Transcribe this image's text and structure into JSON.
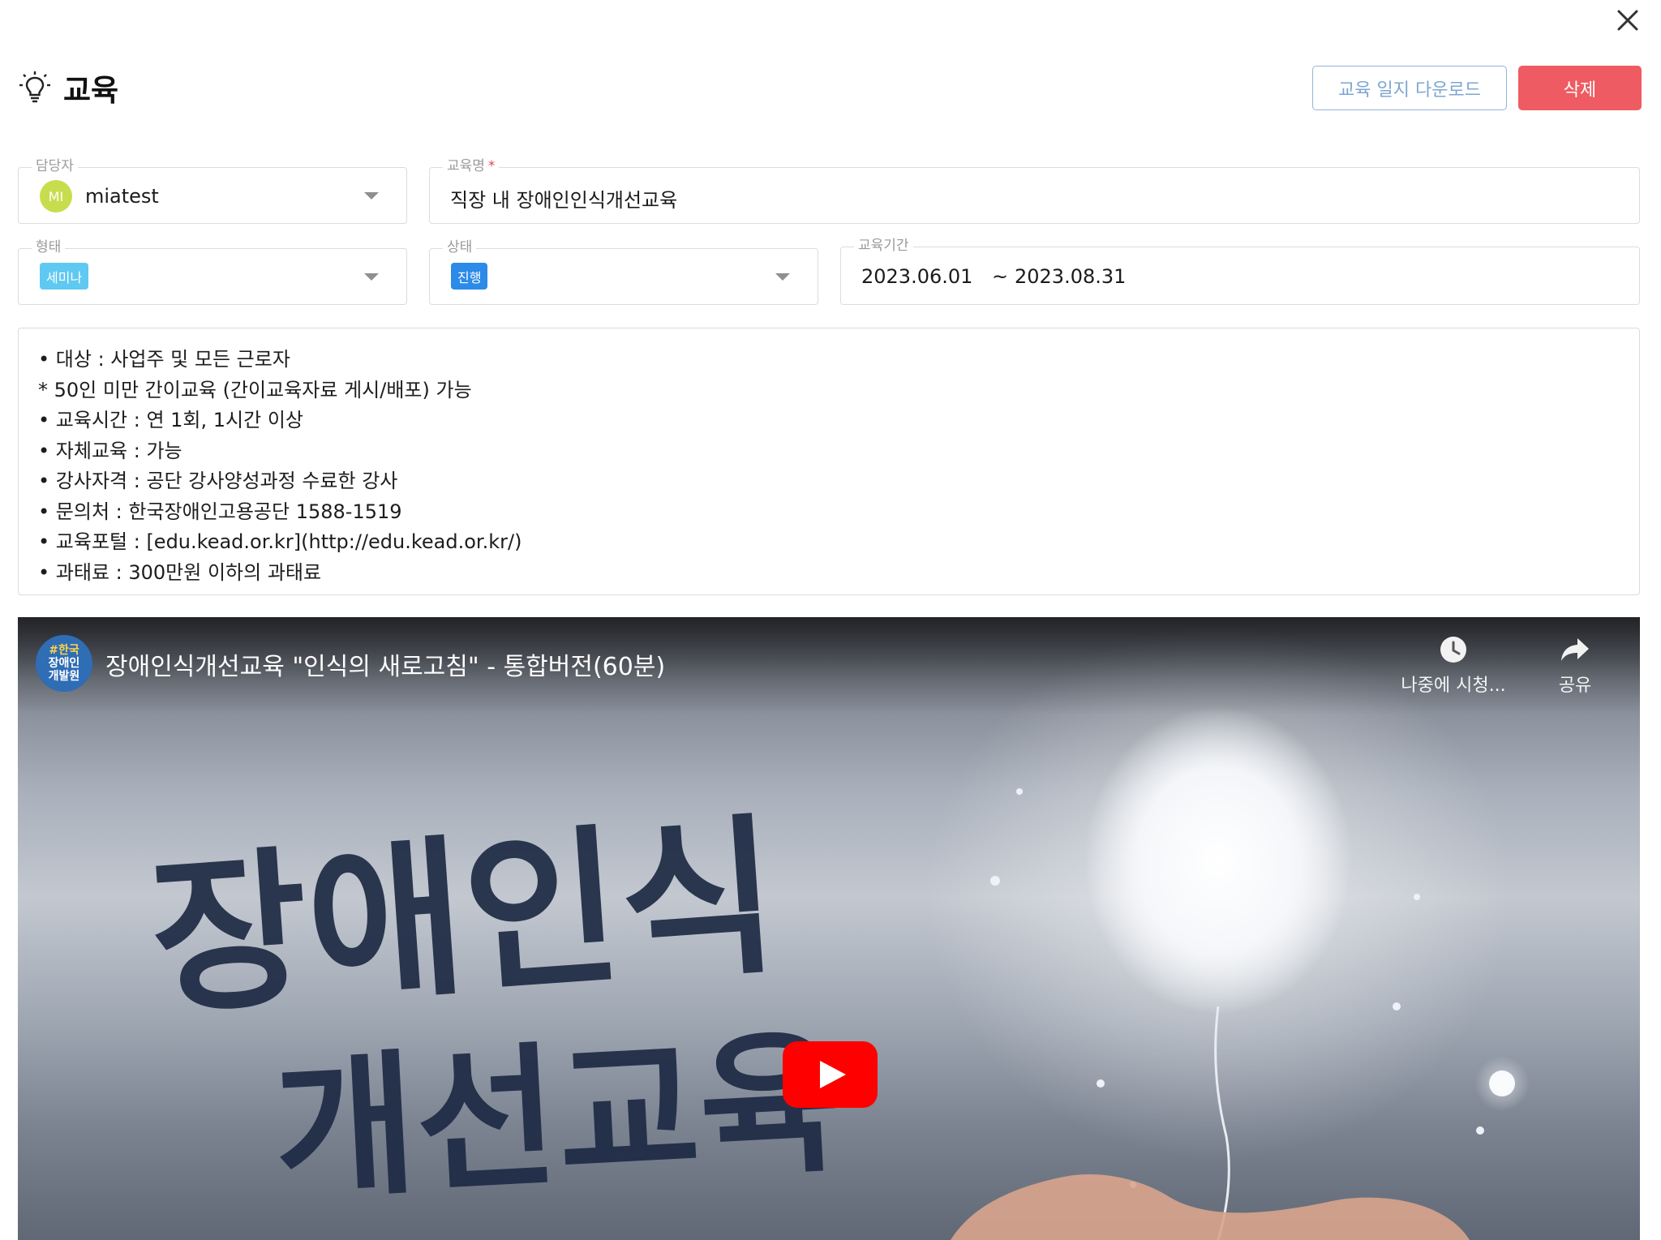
{
  "header": {
    "title": "교육",
    "icon": "lightbulb-icon"
  },
  "actions": {
    "download_label": "교육 일지 다운로드",
    "delete_label": "삭제",
    "close_icon": "close-icon"
  },
  "form": {
    "assignee": {
      "label": "담당자",
      "avatar_initials": "MI",
      "value": "miatest"
    },
    "education_name": {
      "label": "교육명",
      "required_mark": "*",
      "value": "직장 내 장애인인식개선교육"
    },
    "type": {
      "label": "형태",
      "value": "세미나"
    },
    "status": {
      "label": "상태",
      "value": "진행"
    },
    "period": {
      "label": "교육기간",
      "start": "2023.06.01",
      "separator": "~",
      "end": "2023.08.31"
    }
  },
  "description": {
    "lines": [
      "• 대상 : 사업주 및 모든 근로자",
      "* 50인 미만 간이교육 (간이교육자료 게시/배포) 가능",
      "• 교육시간 : 연 1회, 1시간 이상",
      "• 자체교육 : 가능",
      "• 강사자격 : 공단 강사양성과정 수료한 강사",
      "• 문의처 : 한국장애인고용공단 1588-1519",
      "• 교육포털 : [edu.kead.or.kr](http://edu.kead.or.kr/)",
      "• 과태료 : 300만원 이하의 과태료"
    ]
  },
  "video": {
    "title": "장애인식개선교육 \"인식의 새로고침\" - 통합버전(60분)",
    "channel_logo_lines": [
      "#한국",
      "장애인",
      "개발원"
    ],
    "watch_later_label": "나중에 시청...",
    "share_label": "공유",
    "thumbnail_text_line1": "장애인식",
    "thumbnail_text_line2": "개선교육",
    "play_icon": "youtube-play-icon",
    "play_color": "#ff0000"
  }
}
